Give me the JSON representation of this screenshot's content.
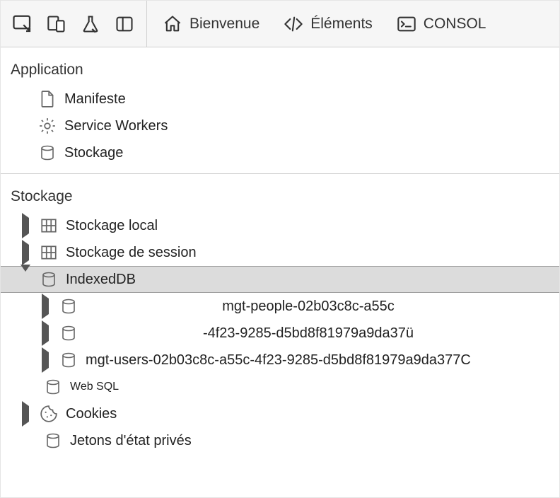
{
  "toolbar": {
    "tabs": {
      "welcome": "Bienvenue",
      "elements": "Éléments",
      "console": "CONSOL"
    }
  },
  "sections": {
    "application": {
      "title": "Application",
      "items": {
        "manifest": "Manifeste",
        "serviceWorkers": "Service Workers",
        "storage": "Stockage"
      }
    },
    "storage": {
      "title": "Stockage",
      "items": {
        "localStorage": "Stockage local",
        "sessionStorage": "Stockage de session",
        "indexedDB": "IndexedDB",
        "idbChildren": [
          "mgt-people-02b03c8c-a55c",
          "-4f23-9285-d5bd8f81979a9da37ü",
          "mgt-users-02b03c8c-a55c-4f23-9285-d5bd8f81979a9da377C"
        ],
        "webSQL": "Web SQL",
        "cookies": "Cookies",
        "privateTokens": "Jetons d'état privés"
      }
    }
  }
}
